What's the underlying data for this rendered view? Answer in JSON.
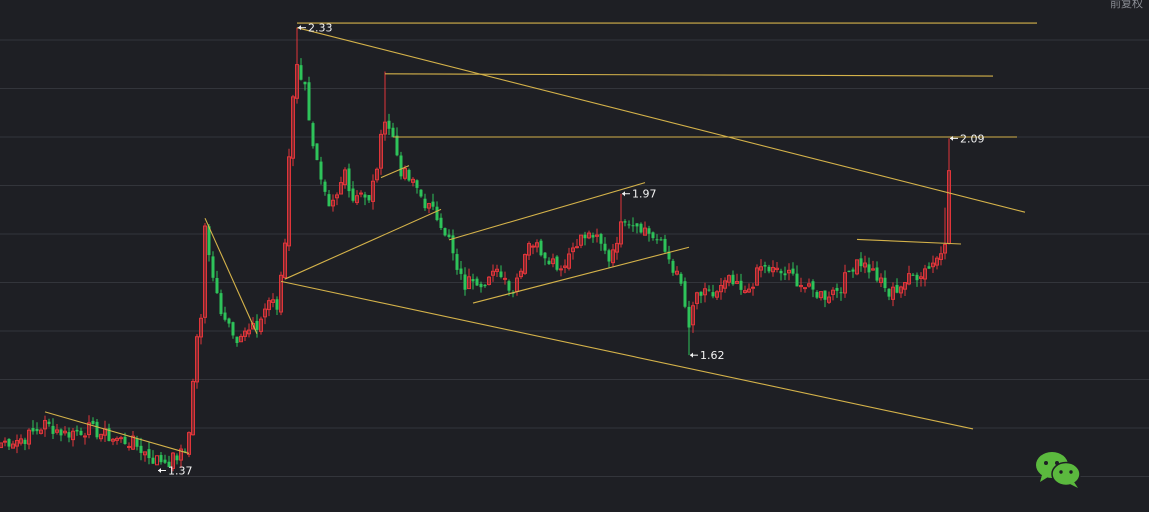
{
  "header": {
    "corner_text": "前复权"
  },
  "colors": {
    "background": "#1e1f24",
    "grid": "#33353b",
    "up": "#e0353a",
    "down": "#2ec35a",
    "trendline": "#d4b24a",
    "label": "#f2f2f2",
    "wechat": "#5bb93e"
  },
  "icons": {
    "share": "wechat-icon"
  },
  "chart_data": {
    "type": "candlestick",
    "title": "",
    "xlabel": "",
    "ylabel": "",
    "ylim": [
      1.28,
      2.39
    ],
    "grid": true,
    "legend": "none",
    "annotations": [
      {
        "text": "2.33",
        "price": 2.33,
        "at_bar": 74
      },
      {
        "text": "1.97",
        "price": 1.97,
        "at_bar": 155
      },
      {
        "text": "1.37",
        "price": 1.37,
        "at_bar": 39
      },
      {
        "text": "1.62",
        "price": 1.62,
        "at_bar": 172
      },
      {
        "text": "2.09",
        "price": 2.09,
        "at_bar": 237
      }
    ],
    "trendlines": [
      {
        "name": "upper-channel",
        "from": {
          "bar": 74,
          "price": 2.33
        },
        "to": {
          "bar": 256,
          "price": 1.93
        }
      },
      {
        "name": "lower-channel",
        "from": {
          "bar": 70,
          "price": 1.78
        },
        "to": {
          "bar": 243,
          "price": 1.46
        }
      },
      {
        "name": "top-horizontal",
        "from": {
          "bar": 74,
          "price": 2.34
        },
        "to": {
          "bar": 259,
          "price": 2.34
        }
      },
      {
        "name": "resistance-2.23",
        "from": {
          "bar": 96,
          "price": 2.23
        },
        "to": {
          "bar": 248,
          "price": 2.225
        }
      },
      {
        "name": "resistance-2.09",
        "from": {
          "bar": 98,
          "price": 2.093
        },
        "to": {
          "bar": 254,
          "price": 2.093
        }
      },
      {
        "name": "early-decline",
        "from": {
          "bar": 11,
          "price": 1.497
        },
        "to": {
          "bar": 47,
          "price": 1.407
        }
      },
      {
        "name": "spike-fall",
        "from": {
          "bar": 51,
          "price": 1.917
        },
        "to": {
          "bar": 64,
          "price": 1.666
        }
      },
      {
        "name": "rising-support",
        "from": {
          "bar": 71,
          "price": 1.785
        },
        "to": {
          "bar": 110,
          "price": 1.936
        }
      },
      {
        "name": "small-rise",
        "from": {
          "bar": 95,
          "price": 2.005
        },
        "to": {
          "bar": 102,
          "price": 2.031
        }
      },
      {
        "name": "flag-top",
        "from": {
          "bar": 112,
          "price": 1.87
        },
        "to": {
          "bar": 161,
          "price": 1.994
        }
      },
      {
        "name": "flag-bottom",
        "from": {
          "bar": 118,
          "price": 1.733
        },
        "to": {
          "bar": 172,
          "price": 1.854
        }
      },
      {
        "name": "final-resistance",
        "from": {
          "bar": 214,
          "price": 1.871
        },
        "to": {
          "bar": 240,
          "price": 1.861
        }
      }
    ],
    "anchors": [
      [
        0,
        1.43
      ],
      [
        6,
        1.44
      ],
      [
        11,
        1.47
      ],
      [
        16,
        1.45
      ],
      [
        22,
        1.46
      ],
      [
        28,
        1.44
      ],
      [
        33,
        1.43
      ],
      [
        38,
        1.395
      ],
      [
        42,
        1.39
      ],
      [
        46,
        1.41
      ],
      [
        47,
        1.46
      ],
      [
        49,
        1.66
      ],
      [
        50,
        1.7
      ],
      [
        51,
        1.9
      ],
      [
        53,
        1.78
      ],
      [
        55,
        1.72
      ],
      [
        57,
        1.69
      ],
      [
        59,
        1.66
      ],
      [
        62,
        1.67
      ],
      [
        64,
        1.68
      ],
      [
        67,
        1.74
      ],
      [
        69,
        1.72
      ],
      [
        71,
        1.87
      ],
      [
        72,
        2.05
      ],
      [
        73,
        2.18
      ],
      [
        74,
        2.25
      ],
      [
        76,
        2.2
      ],
      [
        78,
        2.08
      ],
      [
        80,
        1.99
      ],
      [
        82,
        1.93
      ],
      [
        84,
        1.96
      ],
      [
        86,
        2.02
      ],
      [
        88,
        1.96
      ],
      [
        90,
        1.98
      ],
      [
        92,
        1.95
      ],
      [
        94,
        2.03
      ],
      [
        96,
        2.14
      ],
      [
        98,
        2.09
      ],
      [
        100,
        2.02
      ],
      [
        104,
        1.98
      ],
      [
        106,
        1.95
      ],
      [
        108,
        1.93
      ],
      [
        110,
        1.91
      ],
      [
        112,
        1.87
      ],
      [
        114,
        1.8
      ],
      [
        116,
        1.77
      ],
      [
        118,
        1.79
      ],
      [
        120,
        1.78
      ],
      [
        125,
        1.8
      ],
      [
        128,
        1.76
      ],
      [
        132,
        1.87
      ],
      [
        136,
        1.84
      ],
      [
        140,
        1.81
      ],
      [
        144,
        1.87
      ],
      [
        148,
        1.88
      ],
      [
        152,
        1.83
      ],
      [
        156,
        1.92
      ],
      [
        160,
        1.9
      ],
      [
        164,
        1.87
      ],
      [
        167,
        1.83
      ],
      [
        170,
        1.77
      ],
      [
        172,
        1.68
      ],
      [
        174,
        1.75
      ],
      [
        178,
        1.75
      ],
      [
        182,
        1.78
      ],
      [
        186,
        1.75
      ],
      [
        190,
        1.81
      ],
      [
        194,
        1.8
      ],
      [
        198,
        1.79
      ],
      [
        202,
        1.76
      ],
      [
        206,
        1.75
      ],
      [
        210,
        1.77
      ],
      [
        214,
        1.83
      ],
      [
        218,
        1.8
      ],
      [
        222,
        1.75
      ],
      [
        226,
        1.78
      ],
      [
        230,
        1.8
      ],
      [
        234,
        1.83
      ],
      [
        236,
        1.86
      ],
      [
        237,
        2.02
      ]
    ],
    "candle_count": 238
  }
}
